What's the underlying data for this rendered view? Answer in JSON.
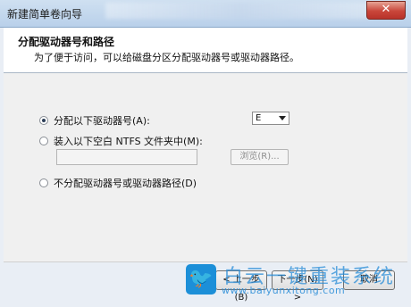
{
  "window": {
    "title": "新建简单卷向导",
    "close_label": "✕"
  },
  "header": {
    "title": "分配驱动器号和路径",
    "subtitle": "为了便于访问，可以给磁盘分区分配驱动器号或驱动器路径。"
  },
  "options": {
    "assign_letter": {
      "label": "分配以下驱动器号(A):",
      "selected": true
    },
    "mount_folder": {
      "label": "装入以下空白 NTFS 文件夹中(M):",
      "selected": false
    },
    "no_assign": {
      "label": "不分配驱动器号或驱动器路径(D)",
      "selected": false
    }
  },
  "drive_letter": {
    "value": "E"
  },
  "folder_path": {
    "value": "",
    "browse_label": "浏览(R)..."
  },
  "footer": {
    "back_label": "< 上一步(B)",
    "next_label": "下一步(N) >",
    "cancel_label": "取消"
  },
  "watermark": {
    "icon": "bird-icon",
    "title": "白云一键重装系统",
    "url": "www.baiyunxitong.com"
  },
  "colors": {
    "titlebar": "#c4d8ee",
    "close": "#c9463a",
    "watermark": "#1c8fd8"
  }
}
